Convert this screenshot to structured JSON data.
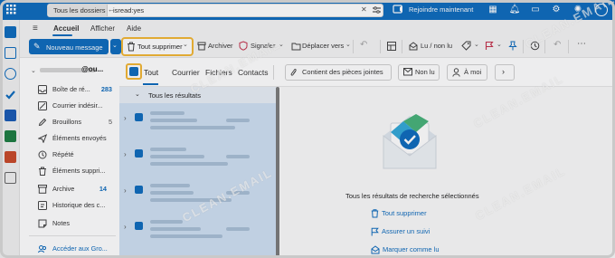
{
  "titlebar": {
    "search_scope": "Tous les dossiers",
    "search_query": "isread:yes",
    "join_now": "Rejoindre maintenant"
  },
  "ribbon": {
    "tabs": [
      "Accueil",
      "Afficher",
      "Aide"
    ]
  },
  "toolbar": {
    "new_message": "Nouveau message",
    "delete_all": "Tout supprimer",
    "archive": "Archiver",
    "report": "Signaler",
    "move_to": "Déplacer vers",
    "read_unread": "Lu / non lu"
  },
  "folders": {
    "account": "@ou...",
    "items": [
      {
        "label": "Boîte de ré...",
        "count": "283",
        "icon": "inbox-icon"
      },
      {
        "label": "Courrier indésir...",
        "count": "",
        "icon": "junk-icon"
      },
      {
        "label": "Brouillons",
        "count": "5",
        "icon": "drafts-icon"
      },
      {
        "label": "Éléments envoyés",
        "count": "",
        "icon": "sent-icon"
      },
      {
        "label": "Répété",
        "count": "",
        "icon": "repeat-icon"
      },
      {
        "label": "Éléments suppri...",
        "count": "",
        "icon": "trash-icon"
      },
      {
        "label": "Archive",
        "count": "14",
        "icon": "archive-icon"
      },
      {
        "label": "Historique des c...",
        "count": "",
        "icon": "history-icon"
      },
      {
        "label": "Notes",
        "count": "",
        "icon": "notes-icon"
      }
    ],
    "go_to_groups": "Accéder aux Gro..."
  },
  "filters": {
    "tabs": [
      "Tout",
      "Courrier",
      "Fichiers",
      "Contacts"
    ],
    "attachments": "Contient des pièces jointes",
    "unread": "Non lu",
    "to_me": "À moi"
  },
  "message_list": {
    "header": "Tous les résultats",
    "rows": 4
  },
  "reading_pane": {
    "message": "Tous les résultats de recherche sélectionnés",
    "actions": [
      "Tout supprimer",
      "Assurer un suivi",
      "Marquer comme lu"
    ]
  },
  "watermark": "CLEAN.EMAIL",
  "colors": {
    "brand": "#0f6cbd",
    "highlight": "#f2b735",
    "selection": "#cfe0f2"
  }
}
